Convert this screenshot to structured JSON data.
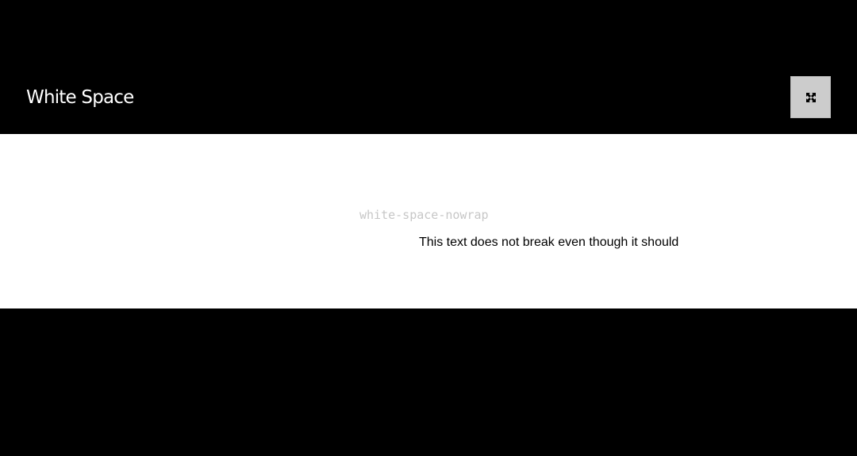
{
  "header": {
    "title": "White Space",
    "fullscreen_icon": "expand-arrows-icon"
  },
  "demo": {
    "class_name": "white-space-nowrap",
    "sample_text": "This text does not break even though it should"
  },
  "colors": {
    "background": "#000000",
    "panel": "#ffffff",
    "button": "#cccccc",
    "label": "#c7c7c7"
  }
}
